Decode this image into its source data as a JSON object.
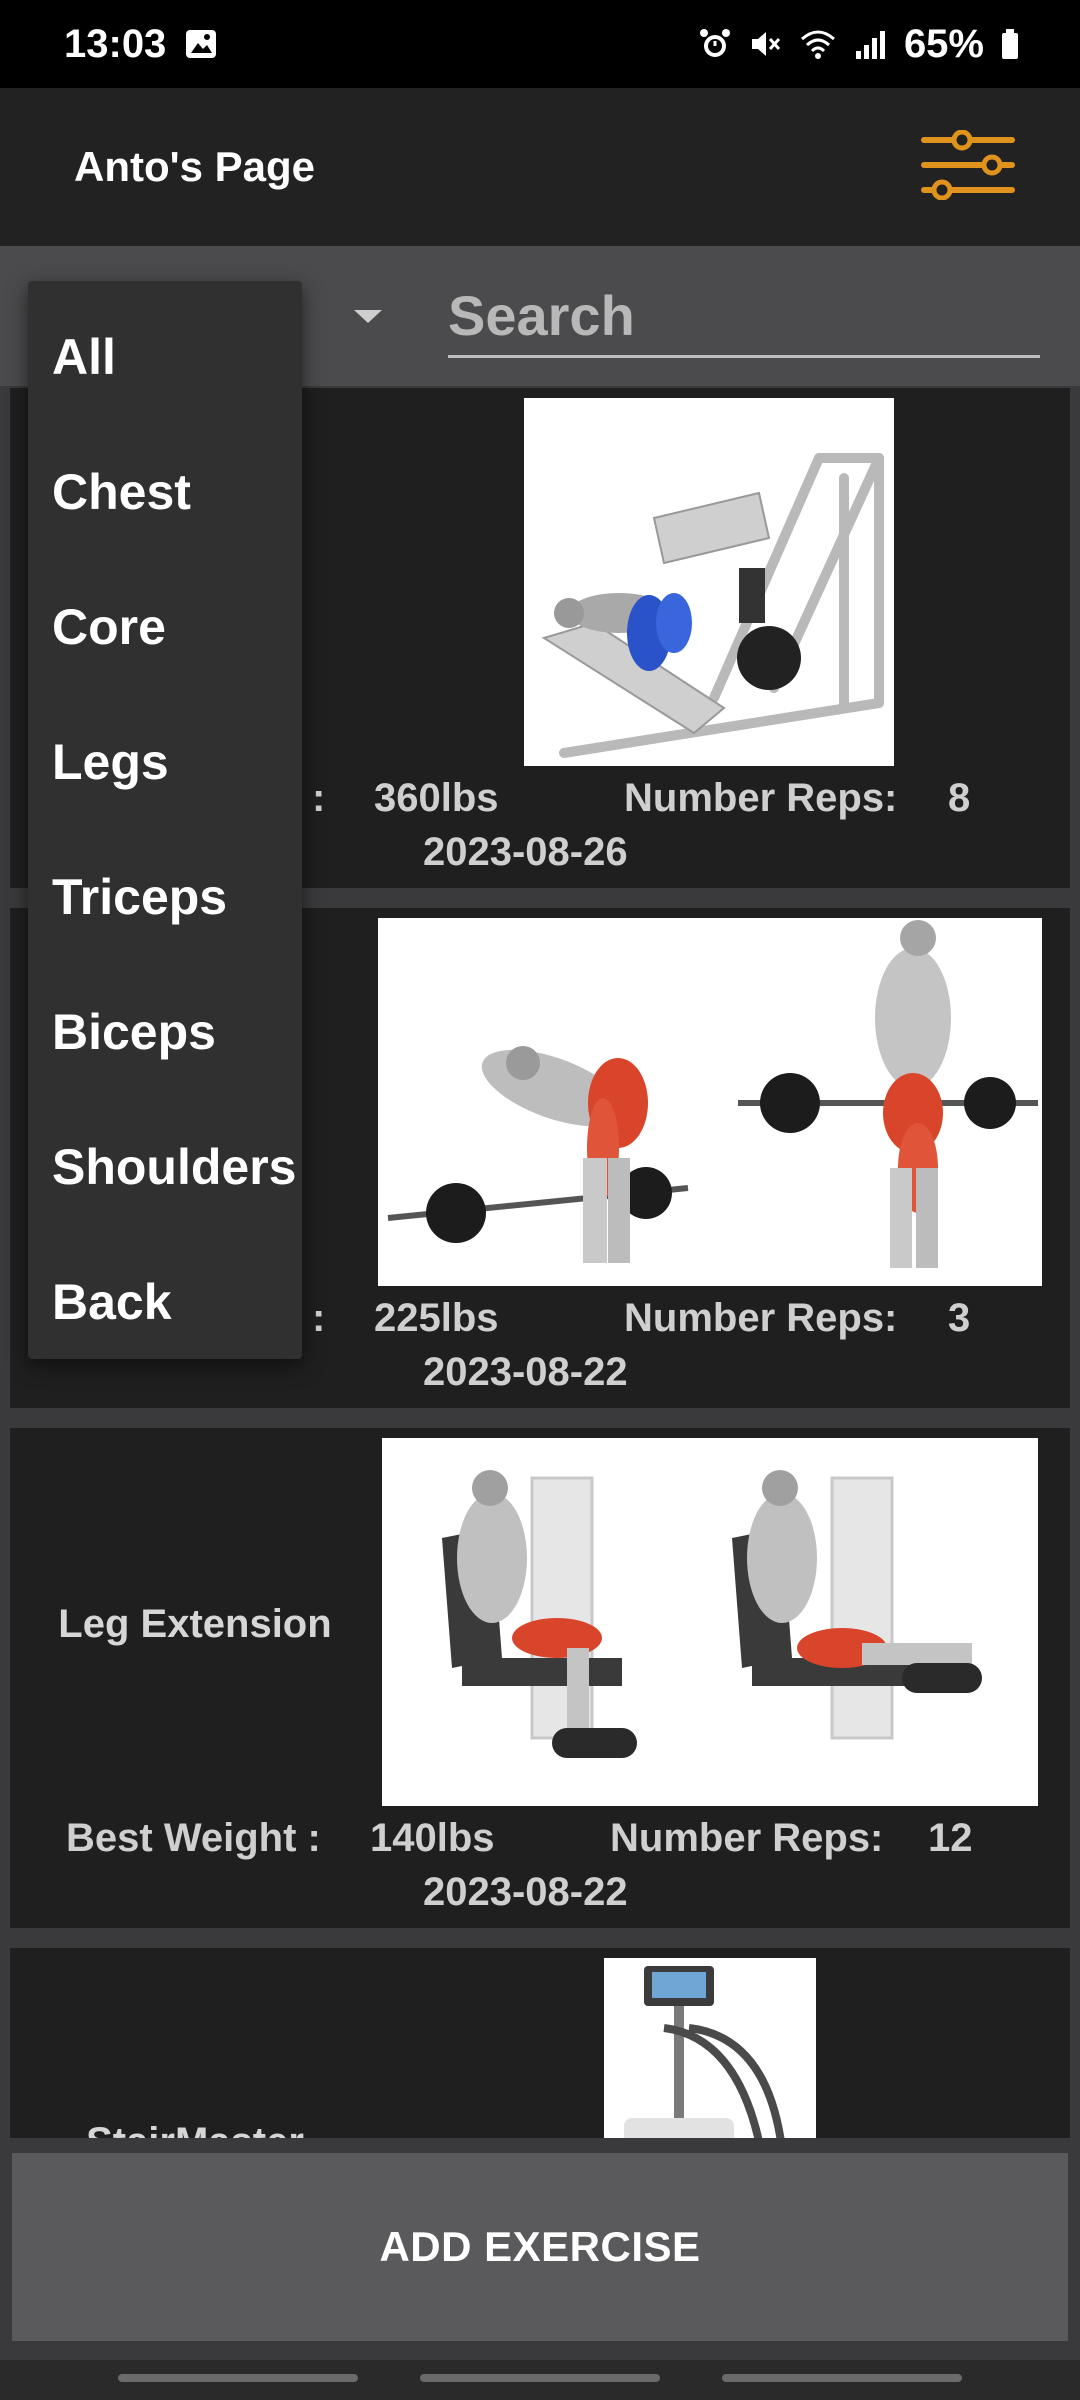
{
  "status_bar": {
    "time": "13:03",
    "battery": "65%"
  },
  "app_bar": {
    "title": "Anto's Page",
    "accent_color": "#e0931c",
    "filter_icon": "sliders-icon"
  },
  "filter": {
    "search_placeholder": "Search"
  },
  "category_menu": {
    "items": [
      "All",
      "Chest",
      "Core",
      "Legs",
      "Triceps",
      "Biceps",
      "Shoulders",
      "Back"
    ]
  },
  "exercises": [
    {
      "name": "",
      "best_weight_label": ":",
      "best_weight": "360lbs",
      "reps_label": "Number Reps:",
      "reps": "8",
      "date": "2023-08-26",
      "image_icon": "leg-press-illustration"
    },
    {
      "name": "",
      "best_weight_label": ":",
      "best_weight": "225lbs",
      "reps_label": "Number Reps:",
      "reps": "3",
      "date": "2023-08-22",
      "image_icon": "romanian-deadlift-illustration"
    },
    {
      "name": "Leg Extension",
      "best_weight_label": "Best Weight :",
      "best_weight": "140lbs",
      "reps_label": "Number Reps:",
      "reps": "12",
      "date": "2023-08-22",
      "image_icon": "leg-extension-illustration"
    },
    {
      "name": "StairMaster",
      "image_icon": "stairmaster-machine-image"
    }
  ],
  "footer": {
    "add_button": "ADD EXERCISE"
  }
}
